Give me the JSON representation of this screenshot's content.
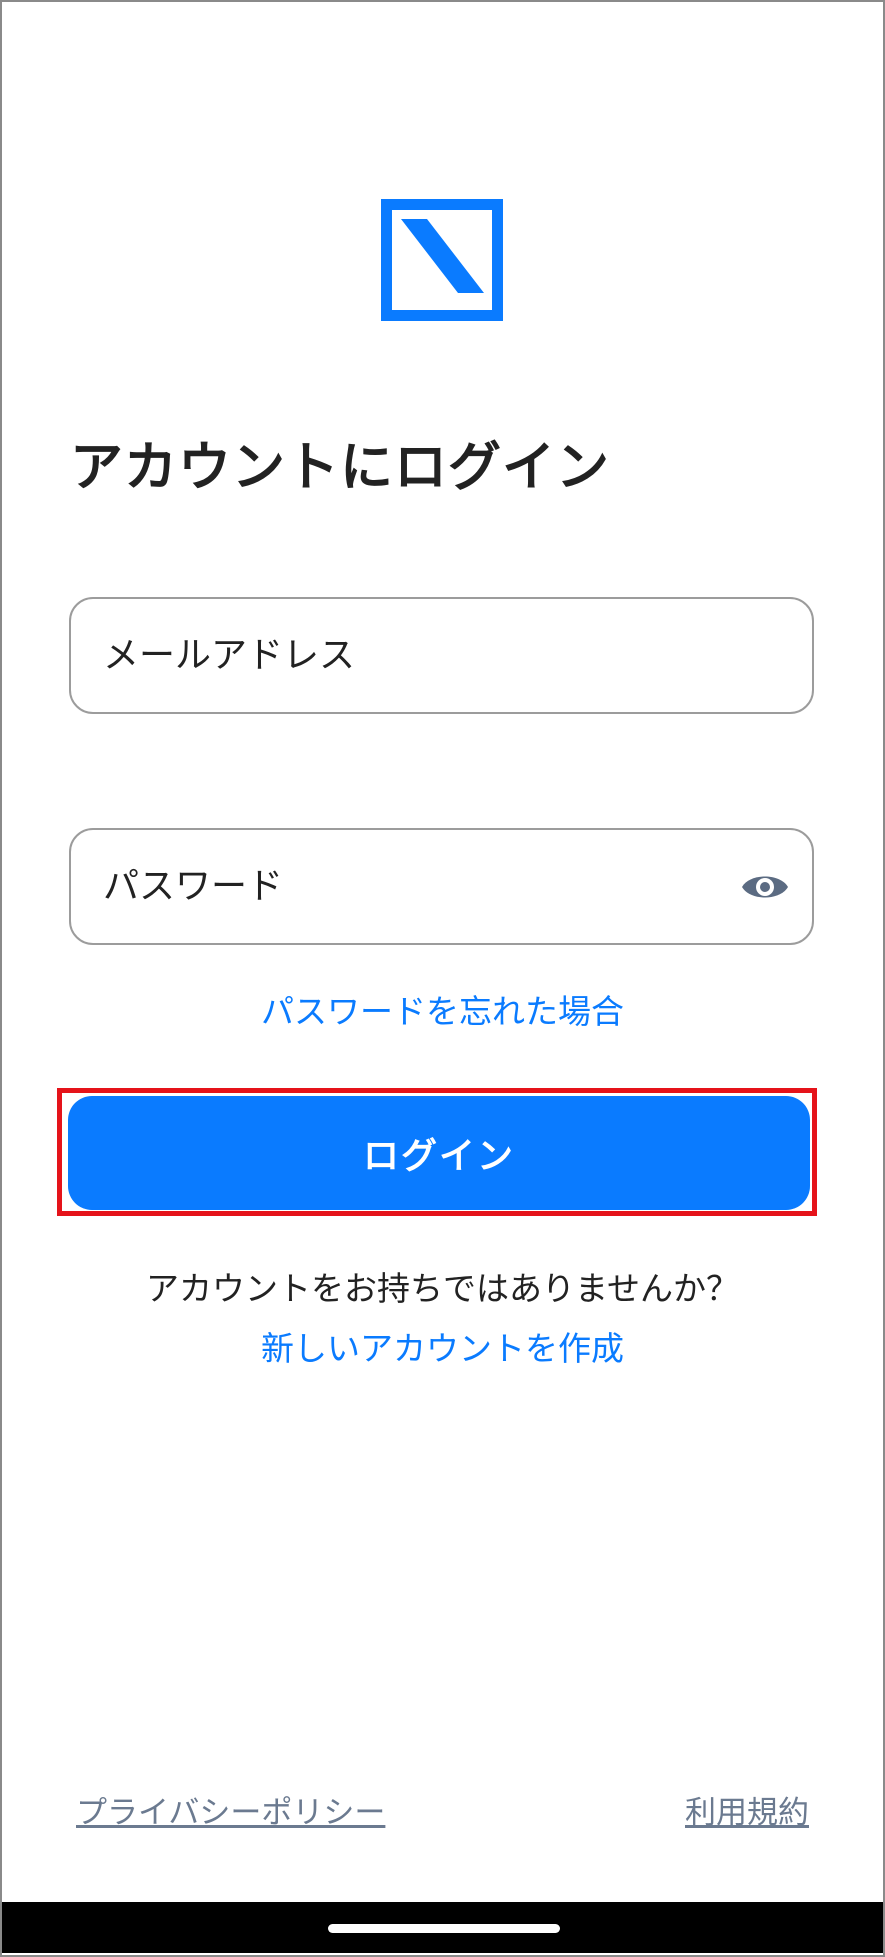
{
  "brand": {
    "logo_icon": "backslash-square-logo",
    "accent_color": "#0a7bff"
  },
  "header": {
    "title": "アカウントにログイン"
  },
  "form": {
    "email": {
      "placeholder": "メールアドレス",
      "value": ""
    },
    "password": {
      "placeholder": "パスワード",
      "value": "",
      "toggle_icon": "eye-icon"
    },
    "forgot_password_link": "パスワードを忘れた場合",
    "login_button_label": "ログイン"
  },
  "signup": {
    "prompt": "アカウントをお持ちではありませんか？",
    "create_account_link": "新しいアカウントを作成"
  },
  "footer": {
    "privacy_policy_link": "プライバシーポリシー",
    "terms_link": "利用規約"
  },
  "highlight": {
    "target": "login-button",
    "color": "#e5131a"
  }
}
